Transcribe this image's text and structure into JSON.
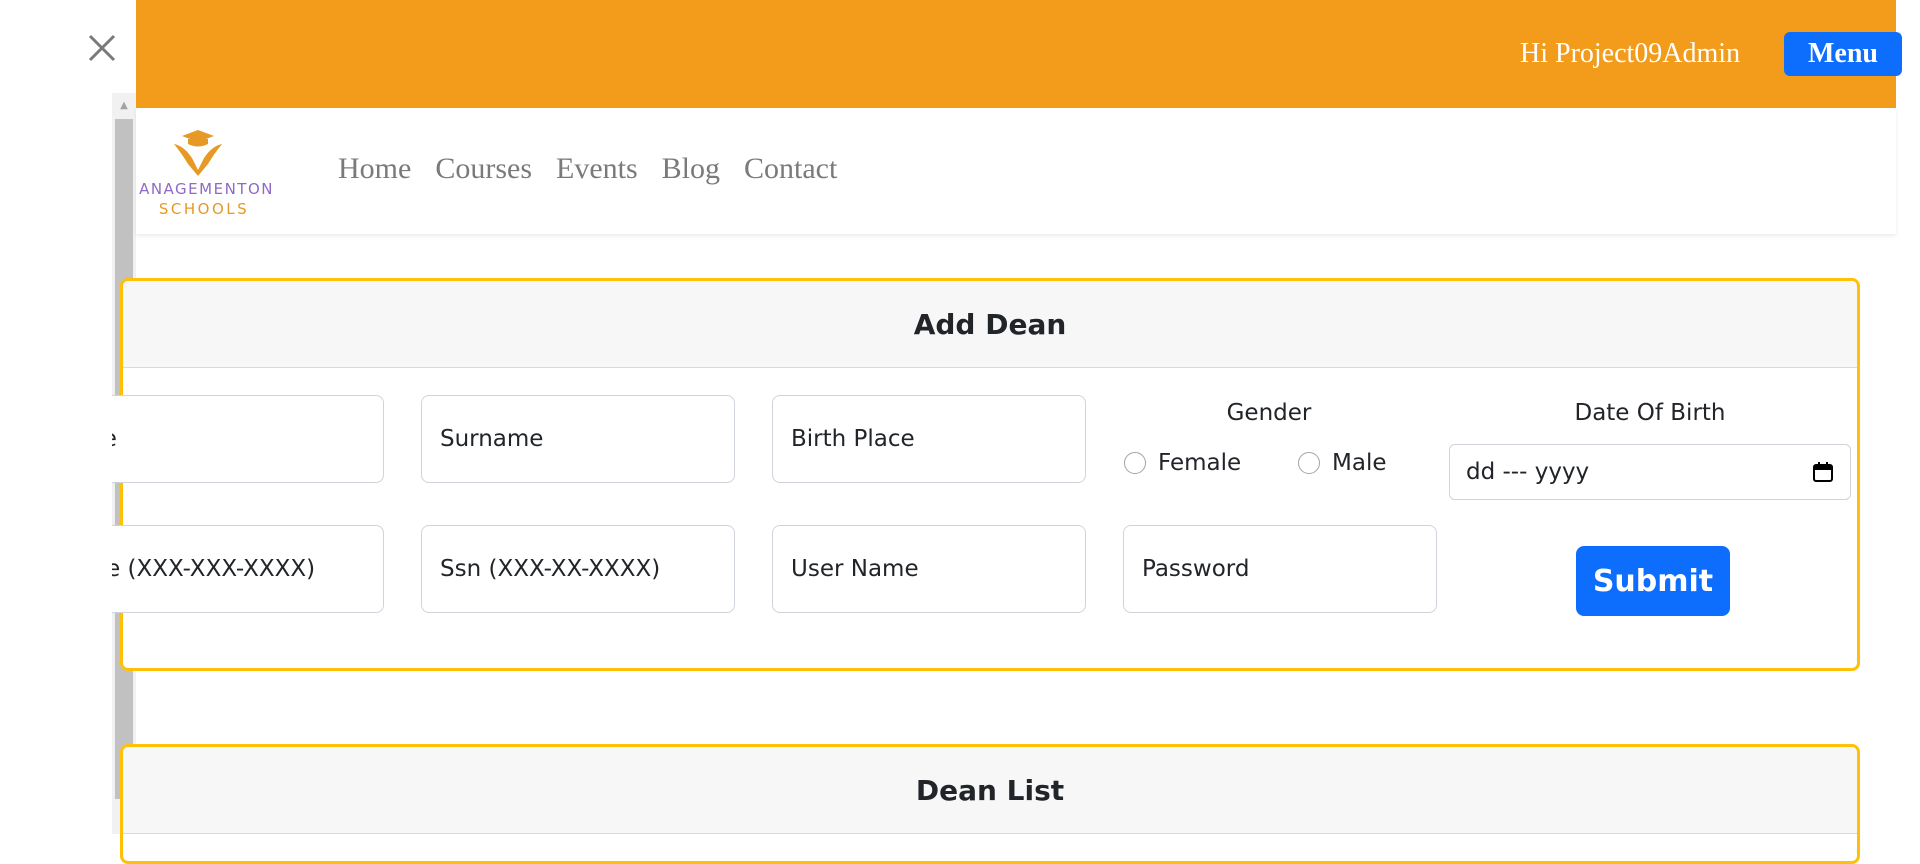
{
  "header": {
    "greeting": "Hi Project09Admin",
    "menu_label": "Menu",
    "bg_color": "#f39c1c"
  },
  "brand": {
    "line1": "ANAGEMENTON",
    "line2": "SCHOOLS"
  },
  "nav": {
    "items": [
      "Home",
      "Courses",
      "Events",
      "Blog",
      "Contact"
    ]
  },
  "add_dean": {
    "title": "Add Dean",
    "fields": {
      "name_placeholder": "Name",
      "surname_placeholder": "Surname",
      "birth_place_placeholder": "Birth Place",
      "phone_placeholder": "Phone (XXX-XXX-XXXX)",
      "ssn_placeholder": "Ssn (XXX-XX-XXXX)",
      "username_placeholder": "User Name",
      "password_placeholder": "Password"
    },
    "gender": {
      "label": "Gender",
      "options": [
        "Female",
        "Male"
      ]
    },
    "dob": {
      "label": "Date Of Birth",
      "value": "dd --- yyyy"
    },
    "submit_label": "Submit"
  },
  "dean_list": {
    "title": "Dean List"
  },
  "colors": {
    "accent": "#0d6efd",
    "card_border": "#ffc107"
  }
}
